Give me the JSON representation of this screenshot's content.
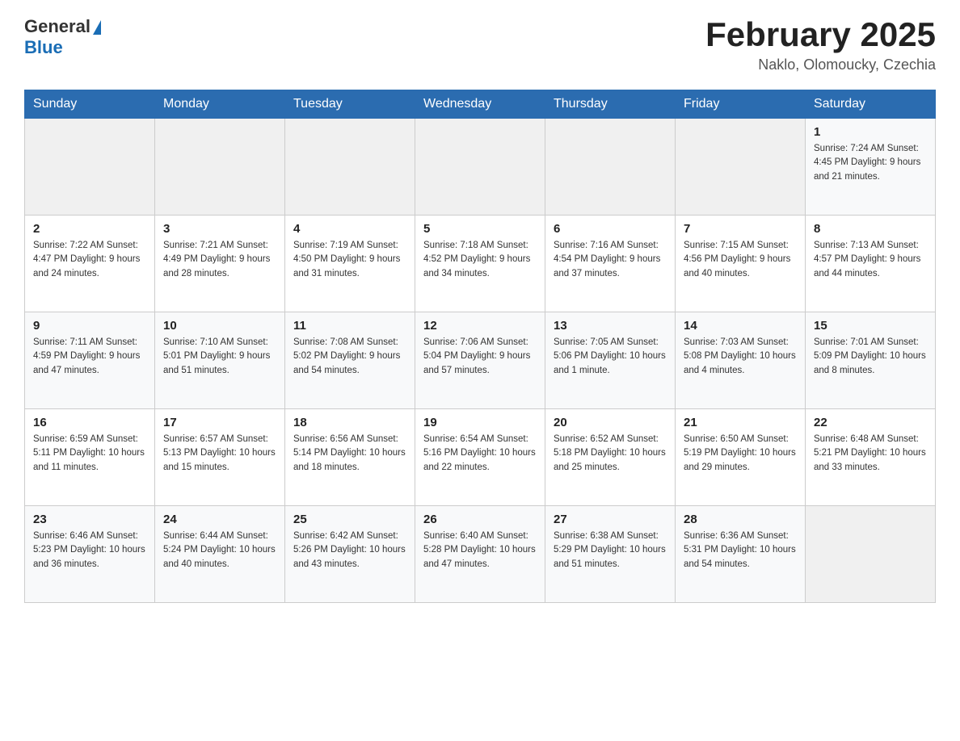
{
  "header": {
    "logo_general": "General",
    "logo_blue": "Blue",
    "month_title": "February 2025",
    "location": "Naklo, Olomoucky, Czechia"
  },
  "days_of_week": [
    "Sunday",
    "Monday",
    "Tuesday",
    "Wednesday",
    "Thursday",
    "Friday",
    "Saturday"
  ],
  "weeks": [
    [
      {
        "day": "",
        "info": ""
      },
      {
        "day": "",
        "info": ""
      },
      {
        "day": "",
        "info": ""
      },
      {
        "day": "",
        "info": ""
      },
      {
        "day": "",
        "info": ""
      },
      {
        "day": "",
        "info": ""
      },
      {
        "day": "1",
        "info": "Sunrise: 7:24 AM\nSunset: 4:45 PM\nDaylight: 9 hours and 21 minutes."
      }
    ],
    [
      {
        "day": "2",
        "info": "Sunrise: 7:22 AM\nSunset: 4:47 PM\nDaylight: 9 hours and 24 minutes."
      },
      {
        "day": "3",
        "info": "Sunrise: 7:21 AM\nSunset: 4:49 PM\nDaylight: 9 hours and 28 minutes."
      },
      {
        "day": "4",
        "info": "Sunrise: 7:19 AM\nSunset: 4:50 PM\nDaylight: 9 hours and 31 minutes."
      },
      {
        "day": "5",
        "info": "Sunrise: 7:18 AM\nSunset: 4:52 PM\nDaylight: 9 hours and 34 minutes."
      },
      {
        "day": "6",
        "info": "Sunrise: 7:16 AM\nSunset: 4:54 PM\nDaylight: 9 hours and 37 minutes."
      },
      {
        "day": "7",
        "info": "Sunrise: 7:15 AM\nSunset: 4:56 PM\nDaylight: 9 hours and 40 minutes."
      },
      {
        "day": "8",
        "info": "Sunrise: 7:13 AM\nSunset: 4:57 PM\nDaylight: 9 hours and 44 minutes."
      }
    ],
    [
      {
        "day": "9",
        "info": "Sunrise: 7:11 AM\nSunset: 4:59 PM\nDaylight: 9 hours and 47 minutes."
      },
      {
        "day": "10",
        "info": "Sunrise: 7:10 AM\nSunset: 5:01 PM\nDaylight: 9 hours and 51 minutes."
      },
      {
        "day": "11",
        "info": "Sunrise: 7:08 AM\nSunset: 5:02 PM\nDaylight: 9 hours and 54 minutes."
      },
      {
        "day": "12",
        "info": "Sunrise: 7:06 AM\nSunset: 5:04 PM\nDaylight: 9 hours and 57 minutes."
      },
      {
        "day": "13",
        "info": "Sunrise: 7:05 AM\nSunset: 5:06 PM\nDaylight: 10 hours and 1 minute."
      },
      {
        "day": "14",
        "info": "Sunrise: 7:03 AM\nSunset: 5:08 PM\nDaylight: 10 hours and 4 minutes."
      },
      {
        "day": "15",
        "info": "Sunrise: 7:01 AM\nSunset: 5:09 PM\nDaylight: 10 hours and 8 minutes."
      }
    ],
    [
      {
        "day": "16",
        "info": "Sunrise: 6:59 AM\nSunset: 5:11 PM\nDaylight: 10 hours and 11 minutes."
      },
      {
        "day": "17",
        "info": "Sunrise: 6:57 AM\nSunset: 5:13 PM\nDaylight: 10 hours and 15 minutes."
      },
      {
        "day": "18",
        "info": "Sunrise: 6:56 AM\nSunset: 5:14 PM\nDaylight: 10 hours and 18 minutes."
      },
      {
        "day": "19",
        "info": "Sunrise: 6:54 AM\nSunset: 5:16 PM\nDaylight: 10 hours and 22 minutes."
      },
      {
        "day": "20",
        "info": "Sunrise: 6:52 AM\nSunset: 5:18 PM\nDaylight: 10 hours and 25 minutes."
      },
      {
        "day": "21",
        "info": "Sunrise: 6:50 AM\nSunset: 5:19 PM\nDaylight: 10 hours and 29 minutes."
      },
      {
        "day": "22",
        "info": "Sunrise: 6:48 AM\nSunset: 5:21 PM\nDaylight: 10 hours and 33 minutes."
      }
    ],
    [
      {
        "day": "23",
        "info": "Sunrise: 6:46 AM\nSunset: 5:23 PM\nDaylight: 10 hours and 36 minutes."
      },
      {
        "day": "24",
        "info": "Sunrise: 6:44 AM\nSunset: 5:24 PM\nDaylight: 10 hours and 40 minutes."
      },
      {
        "day": "25",
        "info": "Sunrise: 6:42 AM\nSunset: 5:26 PM\nDaylight: 10 hours and 43 minutes."
      },
      {
        "day": "26",
        "info": "Sunrise: 6:40 AM\nSunset: 5:28 PM\nDaylight: 10 hours and 47 minutes."
      },
      {
        "day": "27",
        "info": "Sunrise: 6:38 AM\nSunset: 5:29 PM\nDaylight: 10 hours and 51 minutes."
      },
      {
        "day": "28",
        "info": "Sunrise: 6:36 AM\nSunset: 5:31 PM\nDaylight: 10 hours and 54 minutes."
      },
      {
        "day": "",
        "info": ""
      }
    ]
  ]
}
